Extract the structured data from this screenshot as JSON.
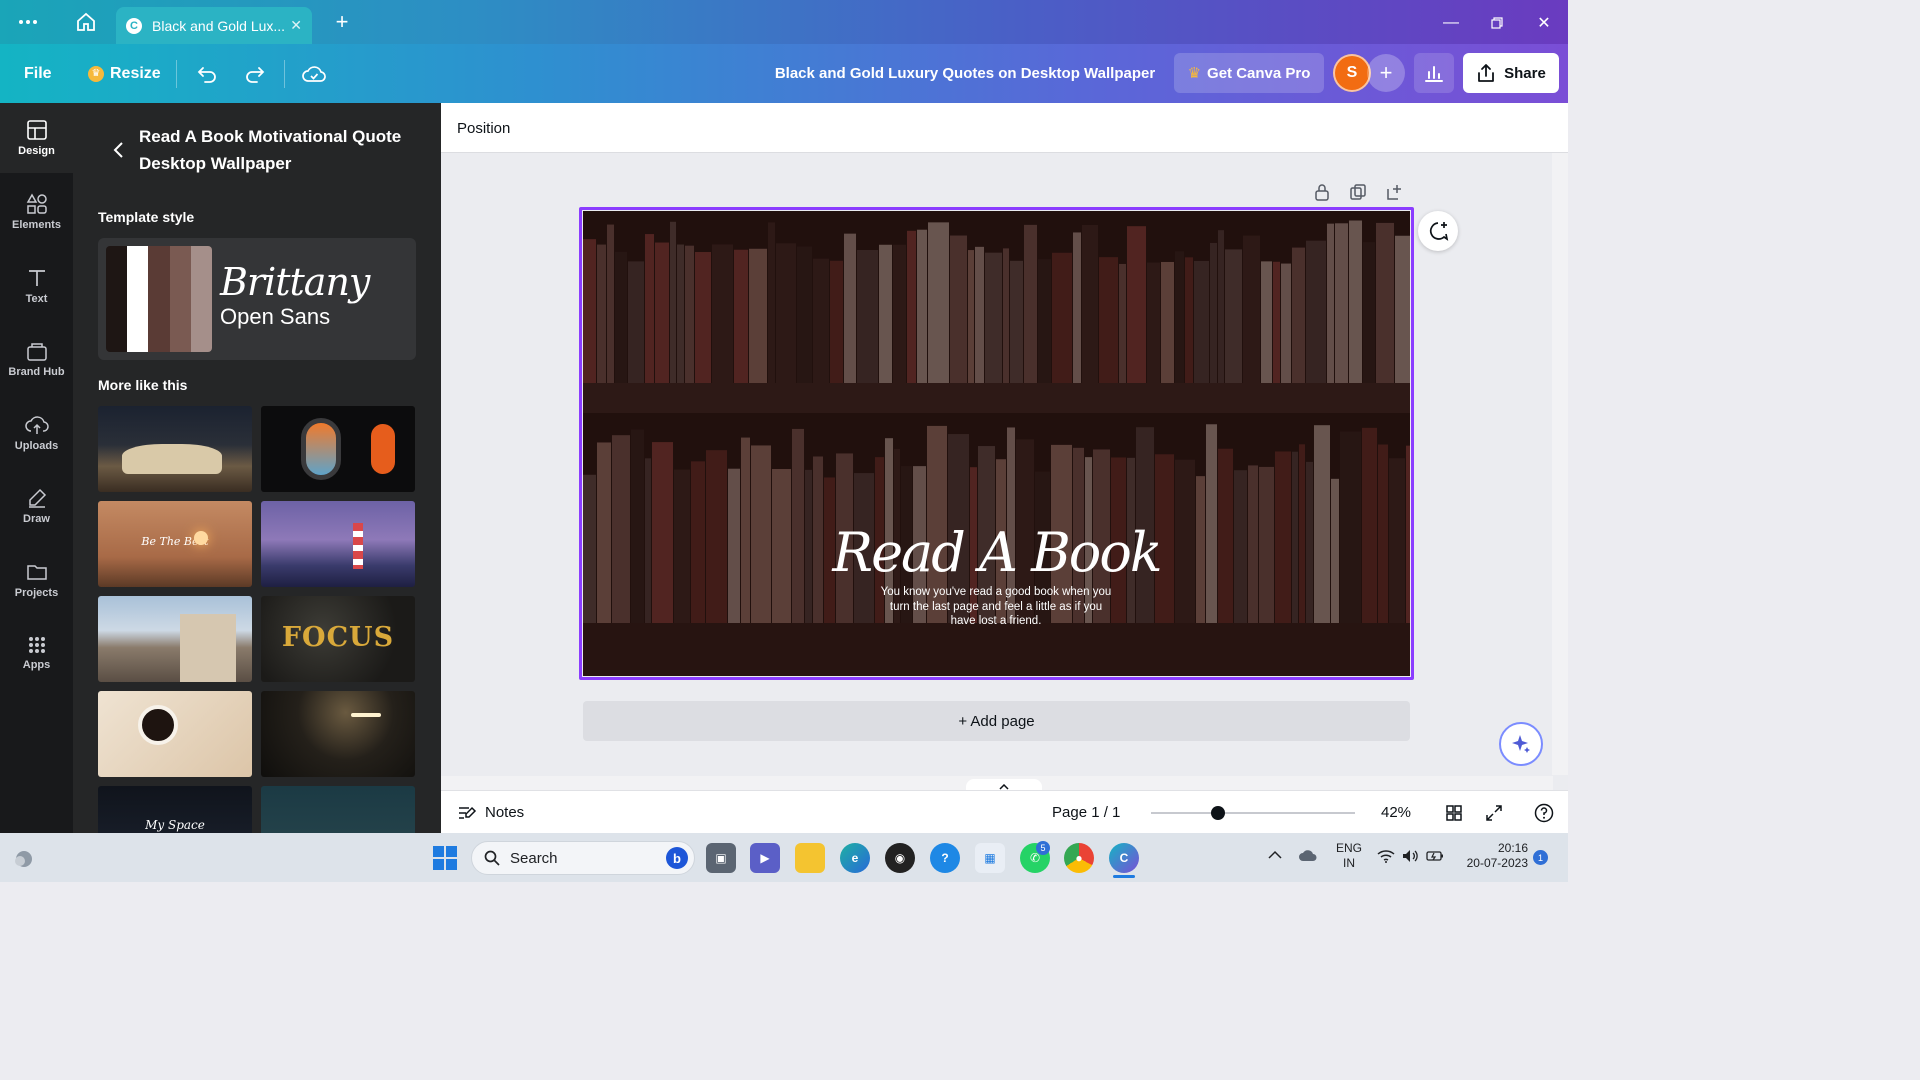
{
  "browser": {
    "tab_title": "Black and Gold Lux...",
    "tab_favicon": "C"
  },
  "toolbar": {
    "file_label": "File",
    "resize_label": "Resize",
    "document_title": "Black and Gold Luxury Quotes on Desktop Wallpaper",
    "get_pro_label": "Get Canva Pro",
    "avatar_initial": "S",
    "share_label": "Share"
  },
  "rail": {
    "items": [
      {
        "label": "Design",
        "icon": "design-icon"
      },
      {
        "label": "Elements",
        "icon": "elements-icon"
      },
      {
        "label": "Text",
        "icon": "text-icon"
      },
      {
        "label": "Brand Hub",
        "icon": "brand-hub-icon"
      },
      {
        "label": "Uploads",
        "icon": "uploads-icon"
      },
      {
        "label": "Draw",
        "icon": "draw-icon"
      },
      {
        "label": "Projects",
        "icon": "projects-icon"
      },
      {
        "label": "Apps",
        "icon": "apps-icon"
      }
    ]
  },
  "panel": {
    "title": "Read A Book Motivational Quote Desktop Wallpaper",
    "template_style_heading": "Template style",
    "palette": [
      "#1e1614",
      "#ffffff",
      "#5a3b35",
      "#7a5a52",
      "#a58f8a"
    ],
    "font_script": "Brittany",
    "font_body": "Open Sans",
    "more_heading": "More like this",
    "thumbnail_texts": [
      "",
      "",
      "Be The Best",
      "",
      "",
      "FOCUS",
      "",
      "",
      "My Space",
      ""
    ]
  },
  "canvas": {
    "position_label": "Position",
    "quote_title": "Read A Book",
    "quote_body": "You know you've read a good book when you turn the last page and feel a little as if you have lost a friend.",
    "add_page_label": "+ Add page"
  },
  "bottombar": {
    "notes_label": "Notes",
    "page_count": "Page 1 / 1",
    "zoom_value": "42%",
    "zoom_fraction": 0.33
  },
  "taskbar": {
    "search_placeholder": "Search",
    "whatsapp_badge": "5",
    "lang_line1": "ENG",
    "lang_line2": "IN",
    "time": "20:16",
    "date": "20-07-2023",
    "notification_count": "1"
  },
  "colors": {
    "accent": "#8b3dff",
    "panel_bg": "#252627",
    "rail_bg": "#18191b",
    "avatar": "#f26c12"
  }
}
